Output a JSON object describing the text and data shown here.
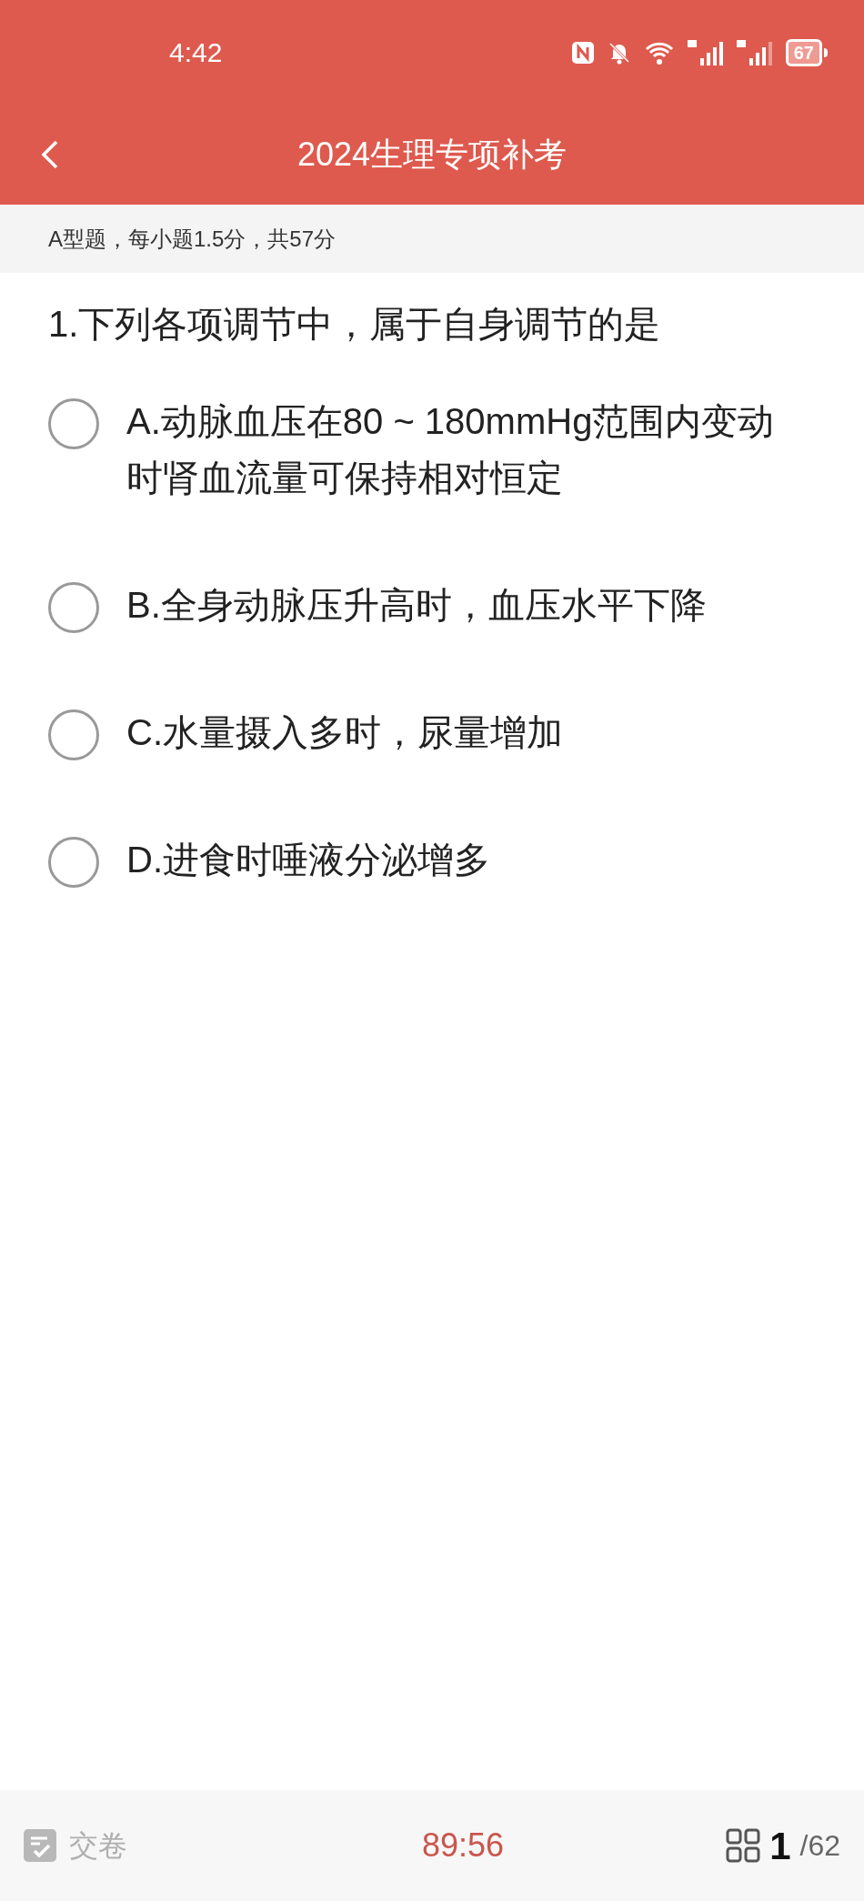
{
  "status_bar": {
    "time": "4:42",
    "battery": "67"
  },
  "header": {
    "title": "2024生理专项补考"
  },
  "section": {
    "label": "A型题，每小题1.5分，共57分"
  },
  "question": {
    "text": "1.下列各项调节中，属于自身调节的是",
    "options": [
      {
        "text": "A.动脉血压在80 ~ 180mmHg范围内变动时肾血流量可保持相对恒定",
        "selected": false
      },
      {
        "text": "B.全身动脉压升高时，血压水平下降",
        "selected": false
      },
      {
        "text": "C.水量摄入多时，尿量增加",
        "selected": false
      },
      {
        "text": "D.进食时唾液分泌增多",
        "selected": false
      }
    ]
  },
  "footer": {
    "submit": "交卷",
    "timer": "89:56",
    "current": "1",
    "total": "/62"
  }
}
